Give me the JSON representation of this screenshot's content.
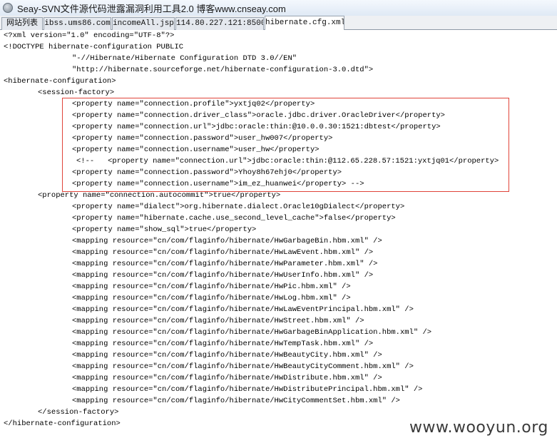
{
  "window": {
    "title": "Seay-SVN文件源代码泄露漏洞利用工具2.0   博客www.cnseay.com",
    "icon": "app-globe-icon"
  },
  "tabs": [
    {
      "label": "网站列表",
      "active": false
    },
    {
      "label": "ibss.ums86.com",
      "active": false
    },
    {
      "label": "incomeAll.jsp",
      "active": false
    },
    {
      "label": "114.80.227.121:8500",
      "active": false
    },
    {
      "label": "hibernate.cfg.xml",
      "active": true
    }
  ],
  "code_lines": [
    "<?xml version=\"1.0\" encoding=\"UTF-8\"?>",
    "<!DOCTYPE hibernate-configuration PUBLIC",
    "\"-//Hibernate/Hibernate Configuration DTD 3.0//EN\"",
    "\"http://hibernate.sourceforge.net/hibernate-configuration-3.0.dtd\">",
    "<hibernate-configuration>",
    "<session-factory>",
    "<property name=\"connection.profile\">yxtjq02</property>",
    "<property name=\"connection.driver_class\">oracle.jdbc.driver.OracleDriver</property>",
    "<property name=\"connection.url\">jdbc:oracle:thin:@10.0.0.30:1521:dbtest</property>",
    "<property name=\"connection.password\">user_hw007</property>",
    "<property name=\"connection.username\">user_hw</property>",
    "<!--   <property name=\"connection.url\">jdbc:oracle:thin:@112.65.228.57:1521:yxtjq01</property>",
    "<property name=\"connection.password\">Yhoy8h67ehj0</property>",
    "<property name=\"connection.username\">im_ez_huanwei</property> -->",
    "<property name=\"connection.autocommit\">true</property>",
    "<property name=\"dialect\">org.hibernate.dialect.Oracle10gDialect</property>",
    "<property name=\"hibernate.cache.use_second_level_cache\">false</property>",
    "<property name=\"show_sql\">true</property>",
    "<mapping resource=\"cn/com/flaginfo/hibernate/HwGarbageBin.hbm.xml\" />",
    "<mapping resource=\"cn/com/flaginfo/hibernate/HwLawEvent.hbm.xml\" />",
    "<mapping resource=\"cn/com/flaginfo/hibernate/HwParameter.hbm.xml\" />",
    "<mapping resource=\"cn/com/flaginfo/hibernate/HwUserInfo.hbm.xml\" />",
    "<mapping resource=\"cn/com/flaginfo/hibernate/HwPic.hbm.xml\" />",
    "<mapping resource=\"cn/com/flaginfo/hibernate/HwLog.hbm.xml\" />",
    "<mapping resource=\"cn/com/flaginfo/hibernate/HwLawEventPrincipal.hbm.xml\" />",
    "<mapping resource=\"cn/com/flaginfo/hibernate/HwStreet.hbm.xml\" />",
    "<mapping resource=\"cn/com/flaginfo/hibernate/HwGarbageBinApplication.hbm.xml\" />",
    "<mapping resource=\"cn/com/flaginfo/hibernate/HwTempTask.hbm.xml\" />",
    "<mapping resource=\"cn/com/flaginfo/hibernate/HwBeautyCity.hbm.xml\" />",
    "<mapping resource=\"cn/com/flaginfo/hibernate/HwBeautyCityComment.hbm.xml\" />",
    "<mapping resource=\"cn/com/flaginfo/hibernate/HwDistribute.hbm.xml\" />",
    "<mapping resource=\"cn/com/flaginfo/hibernate/HwDistributePrincipal.hbm.xml\" />",
    "<mapping resource=\"cn/com/flaginfo/hibernate/HwCityCommentSet.hbm.xml\" />",
    "</session-factory>",
    "</hibernate-configuration>"
  ],
  "watermark": "www.wooyun.org",
  "colors": {
    "highlight_border": "#e0443a",
    "titlebar": "#dfe9f5",
    "tab_active": "#ffffff"
  }
}
